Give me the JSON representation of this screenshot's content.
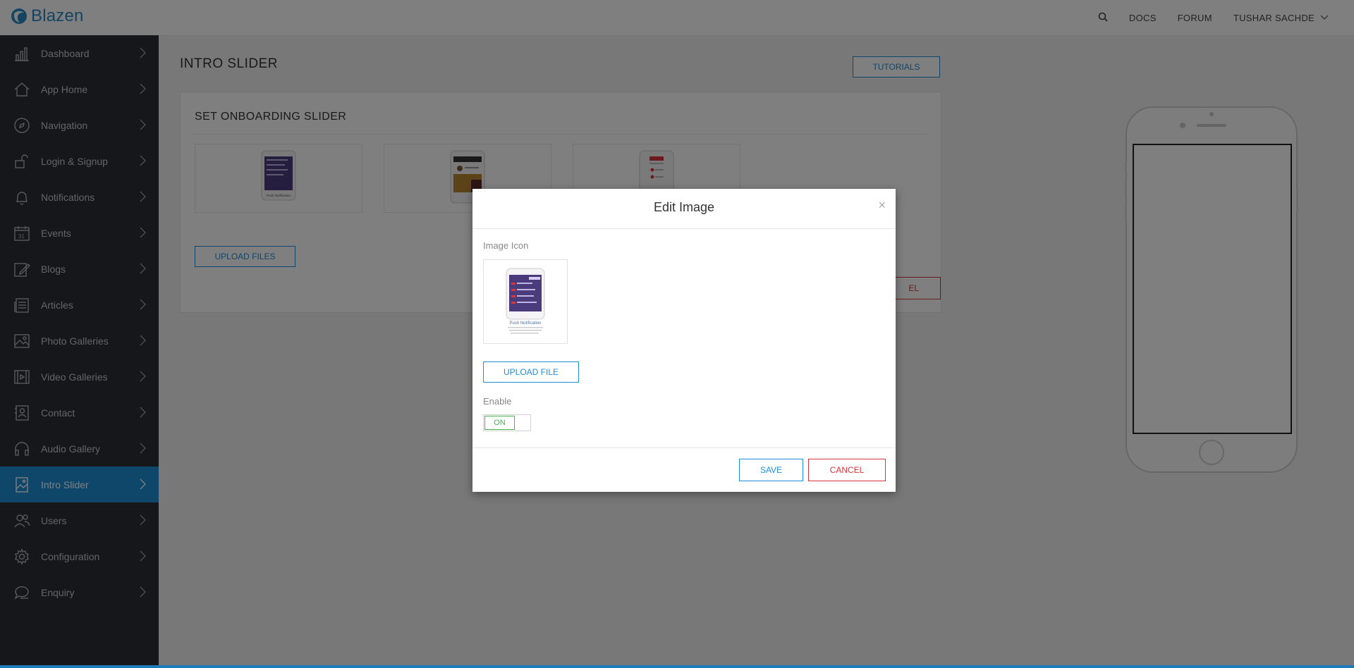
{
  "app": {
    "logo_text": "Blazen"
  },
  "topnav": {
    "search_icon": "search-icon",
    "docs_label": "DOCS",
    "forum_label": "FORUM",
    "user_name": "TUSHAR SACHDE"
  },
  "sidebar": {
    "items": [
      {
        "label": "Dashboard",
        "icon": "bar-chart-icon"
      },
      {
        "label": "App Home",
        "icon": "home-icon"
      },
      {
        "label": "Navigation",
        "icon": "compass-icon"
      },
      {
        "label": "Login & Signup",
        "icon": "unlock-icon"
      },
      {
        "label": "Notifications",
        "icon": "bell-icon"
      },
      {
        "label": "Events",
        "icon": "calendar-icon",
        "icon_text": "31"
      },
      {
        "label": "Blogs",
        "icon": "edit-icon"
      },
      {
        "label": "Articles",
        "icon": "newspaper-icon"
      },
      {
        "label": "Photo Galleries",
        "icon": "image-icon"
      },
      {
        "label": "Video Galleries",
        "icon": "film-icon"
      },
      {
        "label": "Contact",
        "icon": "contact-book-icon"
      },
      {
        "label": "Audio Gallery",
        "icon": "headphones-icon"
      },
      {
        "label": "Intro Slider",
        "icon": "slider-image-icon",
        "active": true
      },
      {
        "label": "Users",
        "icon": "users-icon"
      },
      {
        "label": "Configuration",
        "icon": "gear-icon"
      },
      {
        "label": "Enquiry",
        "icon": "chat-icon"
      }
    ]
  },
  "main": {
    "page_title": "INTRO SLIDER",
    "tutorials_label": "TUTORIALS",
    "panel_title": "SET ONBOARDING SLIDER",
    "thumb_1_caption": "Push Notification",
    "upload_files_label": "UPLOAD FILES",
    "partial_cancel_label": "EL"
  },
  "modal": {
    "title": "Edit Image",
    "close_symbol": "×",
    "image_icon_label": "Image Icon",
    "preview_caption": "Push Notification",
    "upload_file_label": "UPLOAD FILE",
    "enable_label": "Enable",
    "toggle_on_label": "ON",
    "save_label": "SAVE",
    "cancel_label": "CANCEL"
  },
  "colors": {
    "accent": "#1f8fd6",
    "danger": "#d9353b",
    "success": "#44b44a",
    "sidebar_bg": "#2b2f36"
  }
}
